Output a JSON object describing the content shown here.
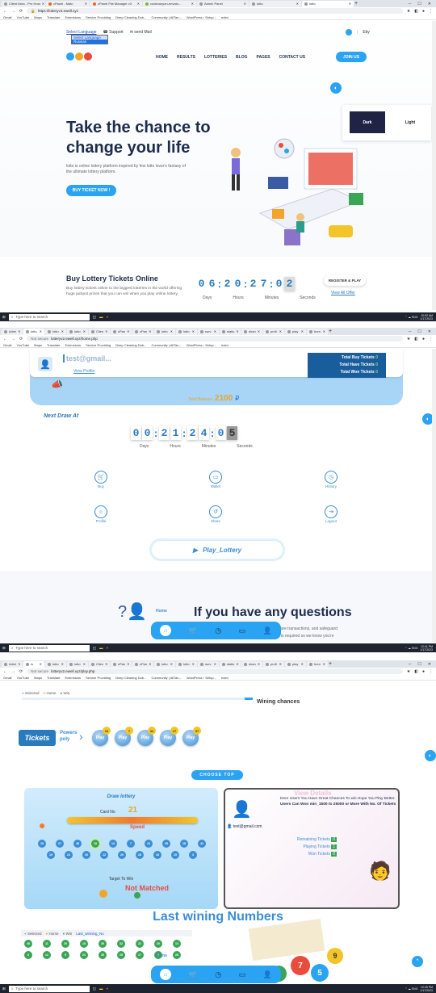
{
  "shot1": {
    "tabs": [
      "Client Area - Pro Host",
      "cPanel - Main",
      "cPanel File Manager v3",
      "codecanyon-envato...",
      "Admin Panel",
      "lotto",
      "lotto"
    ],
    "url": "https://lotteryv3.ewell.xyz",
    "bookmarks": [
      "Gmail",
      "YouTube",
      "Maps",
      "Translate",
      "Extensions",
      "Service Providing",
      "Deep Cleaning Dub...",
      "Community | AllTan...",
      "WordPress › Setup...",
      "eden"
    ],
    "language": {
      "selected": "Select Language",
      "options": [
        "Select Language",
        "Russian"
      ]
    },
    "support_label": "Support",
    "email_label": "send Mail",
    "topbar_right": "Eby",
    "nav": [
      "HOME",
      "RESULTS",
      "LOTTERIES",
      "BLOG",
      "PAGES",
      "CONTACT US"
    ],
    "join_label": "JOIN US",
    "theme": {
      "dark": "Dark",
      "light": "Light"
    },
    "hero_title_line1": "Take the chance to",
    "hero_title_line2": "change your life",
    "hero_text": "lotto is online lottery platform inspired by few lotto lover's fantasy of the ultimate lottery platform.",
    "hero_btn": "BUY TICKET NOW !",
    "buy_title": "Buy Lottery Tickets Online",
    "buy_text": "Buy lottery tickets online to the biggest lotteries in the world offering huge jackpot prizes that you can win when you play online lottery.",
    "countdown": {
      "digits": [
        "0",
        "6",
        "2",
        "0",
        "2",
        "7",
        "0",
        "2"
      ],
      "labels": [
        "Days",
        "Hours",
        "Minutes",
        "Seconds"
      ]
    },
    "register_label": "REGISTER & PLAY",
    "view_offer": "View All Offer",
    "search_placeholder": "Type here to search",
    "time": "10:52 AM",
    "date": "1/17/2023"
  },
  "shot2": {
    "url": "lotteryv2.ewell.xyz/home.php",
    "not_secure": "Not secure",
    "email": "test@gmail...",
    "view_profile": "View Profile",
    "stats": [
      "Total Buy Tickets",
      "Total Have Tickets",
      "Total Won Tickets"
    ],
    "stat_values": [
      "0",
      "0",
      "0"
    ],
    "total_label": "Total Balance",
    "total_value": "2100",
    "next_draw": "Next Draw At",
    "countdown": {
      "digits": [
        "0",
        "0",
        "2",
        "1",
        "2",
        "4",
        "0",
        "5"
      ],
      "labels": [
        "Days",
        "Hours",
        "Minutes",
        "Seconds"
      ]
    },
    "menu": [
      "Buy",
      "Wallet",
      "History",
      "Profile",
      "Share",
      "Logout"
    ],
    "play_label": "Play_Lottery",
    "question": "If you have any questions",
    "question_text": "provide secure transactions, and safeguard",
    "question_text2": "an account is required so we know you're",
    "home_label": "Home",
    "time": "12:41 PM",
    "date": "1/17/2023"
  },
  "shot3": {
    "url": "lotteryv2.ewell.xyz/play.php",
    "legend": [
      "Selected",
      "Home",
      "Win"
    ],
    "wining_chances": "Wining chances",
    "tickets_brand": "Tickets",
    "powers": "Powers",
    "poly": "poly",
    "play_balls": [
      "10",
      "7",
      "31",
      "17",
      "37"
    ],
    "play_label": "Play",
    "choose_top": "CHOOSE TOP",
    "draw_title": "Draw lottery",
    "card_no_label": "Card No",
    "card_no": "21",
    "speed": "Speed",
    "numbers": [
      "15",
      "17",
      "48",
      "18",
      "14",
      "7",
      "13",
      "28",
      "18",
      "41",
      "19",
      "21",
      "30",
      "12",
      "20",
      "28",
      "18",
      "15",
      "3"
    ],
    "target_label": "Target To Win",
    "not_matched": "Not Matched",
    "view_details": "View Details",
    "details_text1": "Deer Users You Have Great Chances To win Hope You Play Better.",
    "details_text2": "Users Can Won min_1500",
    "details_text3": "to 25000",
    "details_text4": "or More With No. Of Tickets",
    "details_email": "test@gmail.com",
    "remaining": "Remaining Tickets",
    "remaining_v": "0",
    "playing": "Playing Tickets",
    "playing_v": "1",
    "won": "Won Tickets",
    "won_v": "0",
    "last_wining": "Last wining Numbers",
    "last_legend": [
      "Selected",
      "Home",
      "Win",
      "Last_winning_No"
    ],
    "last_numbers": [
      "48",
      "11",
      "20",
      "15",
      "39",
      "32",
      "22",
      "20",
      "13",
      "8",
      "12",
      "9",
      "21",
      "39",
      "25",
      "17",
      "9",
      "28"
    ],
    "home_label": "Home",
    "time": "12:49 PM",
    "date": "1/17/2023"
  }
}
